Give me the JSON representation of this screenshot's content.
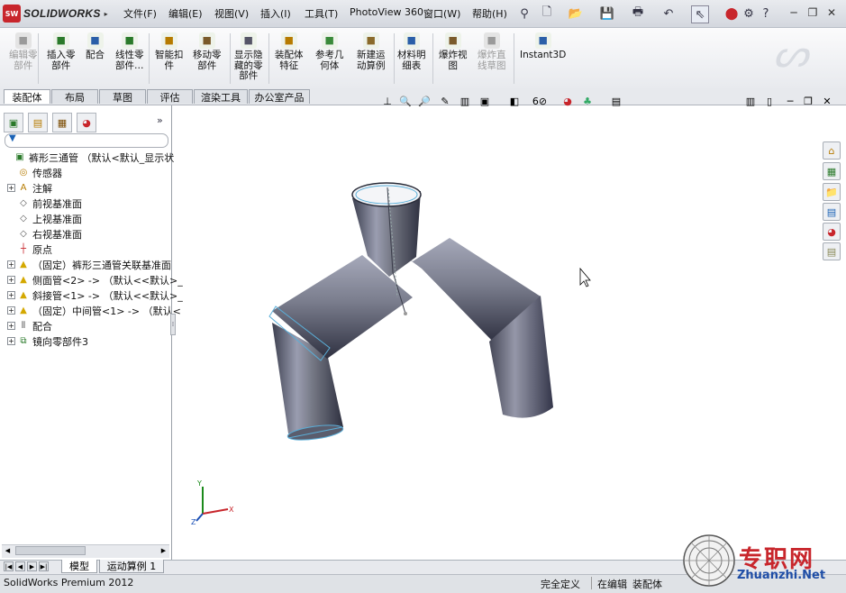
{
  "app": {
    "logo_badge": "SW",
    "logo_name": "SOLIDWORKS"
  },
  "menu": [
    "文件(F)",
    "编辑(E)",
    "视图(V)",
    "插入(I)",
    "工具(T)",
    "PhotoView 360",
    "窗口(W)",
    "帮助(H)"
  ],
  "commands": [
    {
      "label": "编辑零\n部件",
      "disabled": true,
      "icon": "edit-component-icon"
    },
    {
      "label": "插入零\n部件",
      "disabled": false,
      "icon": "insert-component-icon"
    },
    {
      "label": "配合",
      "disabled": false,
      "icon": "mate-icon"
    },
    {
      "label": "线性零\n部件…",
      "disabled": false,
      "icon": "linear-pattern-icon"
    },
    {
      "label": "智能扣\n件",
      "disabled": false,
      "icon": "smart-fastener-icon"
    },
    {
      "label": "移动零\n部件",
      "disabled": false,
      "icon": "move-component-icon"
    },
    {
      "label": "显示隐\n藏的零\n部件",
      "disabled": false,
      "icon": "show-hidden-icon"
    },
    {
      "label": "装配体\n特征",
      "disabled": false,
      "icon": "assembly-feature-icon"
    },
    {
      "label": "参考几\n何体",
      "disabled": false,
      "icon": "reference-geometry-icon"
    },
    {
      "label": "新建运\n动算例",
      "disabled": false,
      "icon": "motion-study-icon"
    },
    {
      "label": "材料明\n细表",
      "disabled": false,
      "icon": "bom-icon"
    },
    {
      "label": "爆炸视\n图",
      "disabled": false,
      "icon": "explode-view-icon"
    },
    {
      "label": "爆炸直\n线草图",
      "disabled": true,
      "icon": "explode-line-icon"
    },
    {
      "label": "Instant3D",
      "disabled": false,
      "icon": "instant3d-icon"
    }
  ],
  "tabs": [
    "装配体",
    "布局",
    "草图",
    "评估",
    "渲染工具",
    "办公室产品"
  ],
  "tree": [
    {
      "label": "裤形三通管  （默认<默认_显示状",
      "expander": "",
      "icon": "assembly-icon",
      "indent": 0
    },
    {
      "label": "传感器",
      "expander": "",
      "icon": "sensor-icon",
      "indent": 1
    },
    {
      "label": "注解",
      "expander": "+",
      "icon": "annotation-icon",
      "indent": 1
    },
    {
      "label": "前视基准面",
      "expander": "",
      "icon": "plane-icon",
      "indent": 1
    },
    {
      "label": "上视基准面",
      "expander": "",
      "icon": "plane-icon",
      "indent": 1
    },
    {
      "label": "右视基准面",
      "expander": "",
      "icon": "plane-icon",
      "indent": 1
    },
    {
      "label": "原点",
      "expander": "",
      "icon": "origin-icon",
      "indent": 1
    },
    {
      "label": "（固定）裤形三通管关联基准面",
      "expander": "+",
      "icon": "part-icon",
      "indent": 1
    },
    {
      "label": "侧面管<2> -> （默认<<默认>_",
      "expander": "+",
      "icon": "part-icon",
      "indent": 1
    },
    {
      "label": "斜接管<1> -> （默认<<默认>_",
      "expander": "+",
      "icon": "part-icon",
      "indent": 1
    },
    {
      "label": "（固定）中间管<1> -> （默认<",
      "expander": "+",
      "icon": "part-icon",
      "indent": 1
    },
    {
      "label": "配合",
      "expander": "+",
      "icon": "mates-icon",
      "indent": 1
    },
    {
      "label": "镜向零部件3",
      "expander": "+",
      "icon": "mirror-icon",
      "indent": 1
    }
  ],
  "bottom_tabs": [
    "模型",
    "运动算例 1"
  ],
  "status": {
    "product": "SolidWorks Premium 2012",
    "state1": "完全定义",
    "state2": "在编辑",
    "state3": "装配体"
  },
  "triad": {
    "x": "X",
    "y": "Y",
    "z": "Z"
  },
  "watermark": {
    "title": "专职网",
    "url": "Zhuanzhi.Net"
  },
  "colors": {
    "accent_red": "#c8262c",
    "model_fill": "#5f6274",
    "selection": "#55a6d6"
  }
}
